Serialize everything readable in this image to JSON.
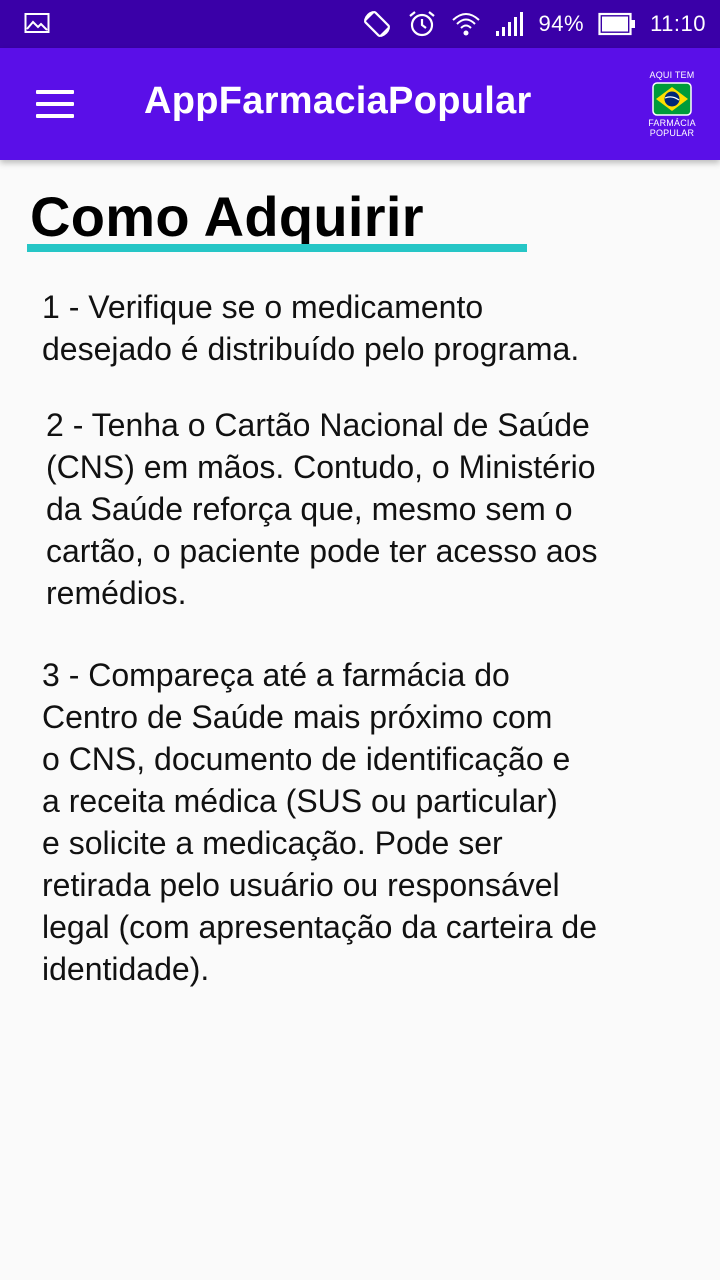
{
  "status_bar": {
    "icons": [
      "picture-icon",
      "auto-rotate-icon",
      "alarm-icon",
      "wifi-icon",
      "signal-icon"
    ],
    "battery_percent": "94%",
    "time": "11:10"
  },
  "app_bar": {
    "menu_icon": "menu-icon",
    "title": "AppFarmaciaPopular",
    "logo": {
      "top_text": "AQUI TEM",
      "bottom_line1": "FARMÁCIA",
      "bottom_line2": "POPULAR"
    }
  },
  "content": {
    "title": "Como Adquirir",
    "steps": [
      {
        "line1": "1 - Verifique se o medicamento",
        "line2": "desejado é distribuído pelo programa."
      },
      {
        "line1": "2 - Tenha o Cartão Nacional de Saúde",
        "line2": "(CNS) em mãos. Contudo, o Ministério",
        "line3": "da Saúde reforça que, mesmo sem o",
        "line4": "cartão, o paciente pode ter acesso aos",
        "line5": "remédios."
      },
      {
        "line1": "3 - Compareça até a farmácia do",
        "line2": "Centro de Saúde mais próximo com",
        "line3": "o CNS, documento de identificação e",
        "line4": "a receita médica (SUS ou particular)",
        "line5": "e solicite a medicação. Pode ser",
        "line6": "retirada pelo usuário ou responsável",
        "line7": "legal (com apresentação da carteira de",
        "line8": "identidade)."
      }
    ]
  },
  "colors": {
    "status_bar": "#3A00A8",
    "app_bar": "#5A0FE8",
    "accent_underline": "#26C6C6",
    "background": "#FAFAFA"
  }
}
